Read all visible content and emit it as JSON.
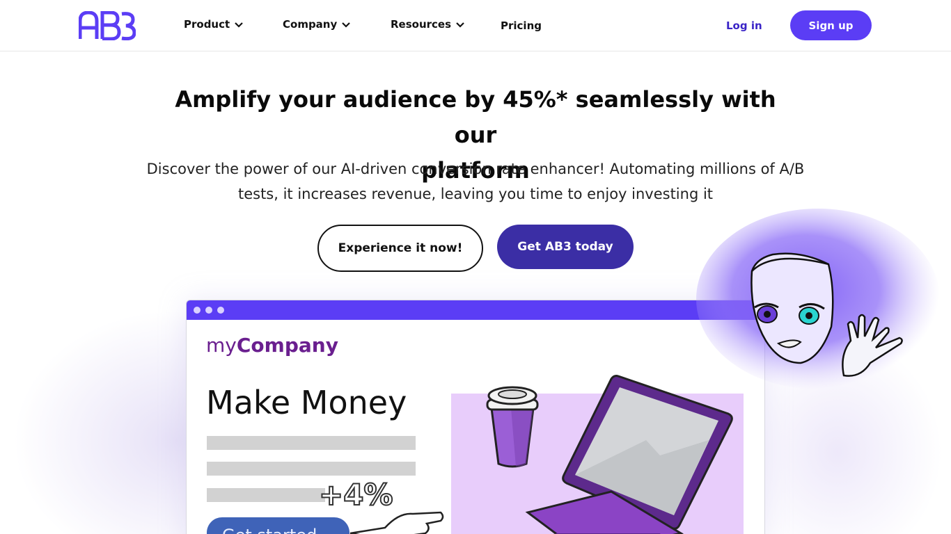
{
  "header": {
    "logo_text": "AB3",
    "nav": [
      {
        "label": "Product",
        "has_dropdown": true
      },
      {
        "label": "Company",
        "has_dropdown": true
      },
      {
        "label": "Resources",
        "has_dropdown": true
      },
      {
        "label": "Pricing",
        "has_dropdown": false
      }
    ],
    "login_label": "Log in",
    "signup_label": "Sign up"
  },
  "hero": {
    "title_line1": "Amplify your audience by 45%* seamlessly with our",
    "title_line2": "platform",
    "subtitle_line1": "Discover the power of our AI-driven conversion rate enhancer! Automating millions of A/B",
    "subtitle_line2": "tests, it increases revenue, leaving you time to enjoy investing it",
    "btn_secondary": "Experience it now!",
    "btn_primary": "Get AB3 today"
  },
  "mockup": {
    "brand_light": "my",
    "brand_bold": "Company",
    "headline": "Make Money",
    "badge": "+4%",
    "cta": "Get started"
  },
  "colors": {
    "accent": "#5b3df5",
    "primary_button": "#3b2ea5",
    "login_link": "#3a24c7",
    "brand_purple": "#6a1f8f",
    "panel": "#e8cdfb"
  }
}
